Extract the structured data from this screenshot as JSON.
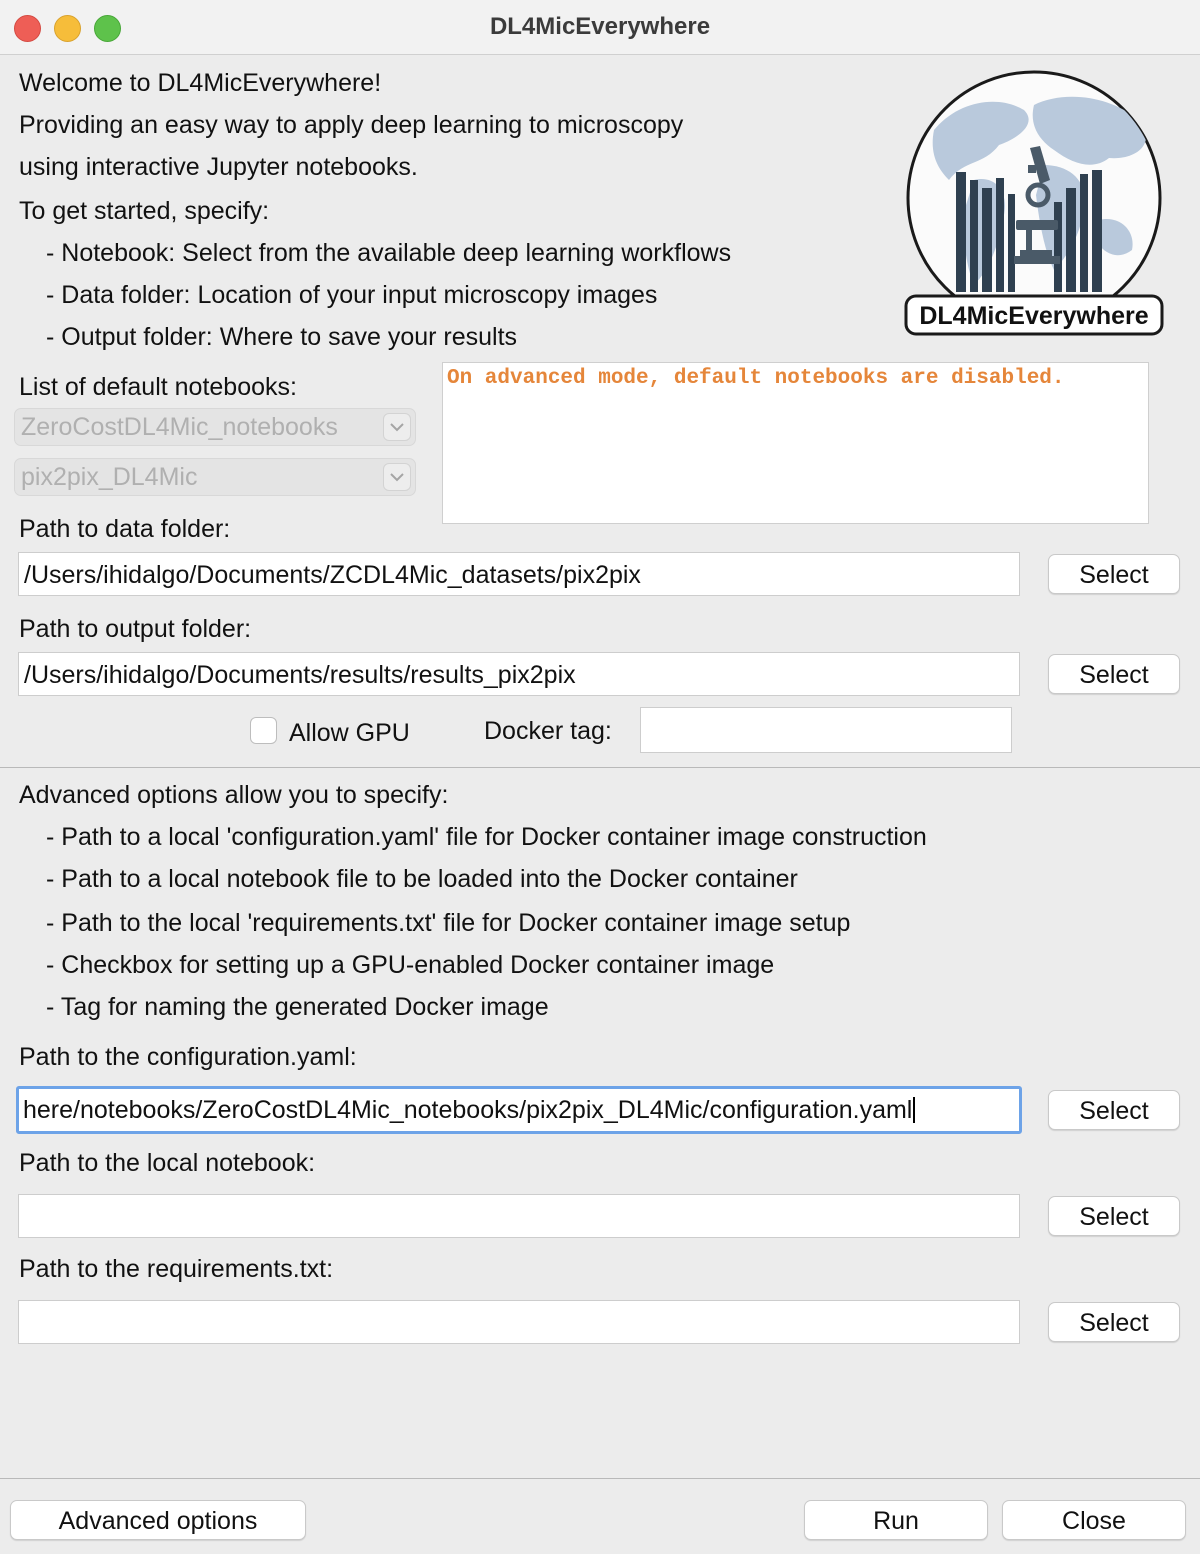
{
  "window": {
    "title": "DL4MicEverywhere"
  },
  "intro": {
    "line1": "Welcome to DL4MicEverywhere!",
    "line2": "Providing an easy way to apply deep learning to microscopy",
    "line3": "using interactive Jupyter notebooks.",
    "line4": "To get started, specify:",
    "bullets": [
      "- Notebook: Select from the available deep learning workflows",
      "- Data folder: Location of your input microscopy images",
      "- Output folder: Where to save your results"
    ]
  },
  "logo": {
    "text": "DL4MicEverywhere",
    "icon": "globe-microscope-logo"
  },
  "notebooks": {
    "label": "List of default notebooks:",
    "collection_value": "ZeroCostDL4Mic_notebooks",
    "notebook_value": "pix2pix_DL4Mic",
    "message": "On advanced mode, default notebooks are disabled."
  },
  "data_folder": {
    "label": "Path to data folder:",
    "value": "/Users/ihidalgo/Documents/ZCDL4Mic_datasets/pix2pix",
    "button": "Select"
  },
  "output_folder": {
    "label": "Path to output folder:",
    "value": "/Users/ihidalgo/Documents/results/results_pix2pix",
    "button": "Select"
  },
  "gpu": {
    "label": "Allow GPU",
    "checked": false
  },
  "docker_tag": {
    "label": "Docker tag:",
    "value": ""
  },
  "advanced": {
    "heading": "Advanced options allow you to specify:",
    "bullets": [
      "- Path to a local 'configuration.yaml' file for Docker container image construction",
      "- Path to a local notebook file to be loaded into the Docker container",
      "- Path to the local 'requirements.txt' file for Docker container image setup",
      "- Checkbox for setting up a GPU-enabled Docker container image",
      "- Tag for naming the generated Docker image"
    ]
  },
  "config_yaml": {
    "label": "Path to the configuration.yaml:",
    "value": "here/notebooks/ZeroCostDL4Mic_notebooks/pix2pix_DL4Mic/configuration.yaml",
    "button": "Select"
  },
  "local_notebook": {
    "label": "Path to the local notebook:",
    "value": "",
    "button": "Select"
  },
  "requirements": {
    "label": "Path to the requirements.txt:",
    "value": "",
    "button": "Select"
  },
  "footer": {
    "advanced_button": "Advanced options",
    "run_button": "Run",
    "close_button": "Close"
  },
  "colors": {
    "message": "#e5863a",
    "focus_ring": "#6da3e8",
    "window_bg": "#ececec"
  }
}
